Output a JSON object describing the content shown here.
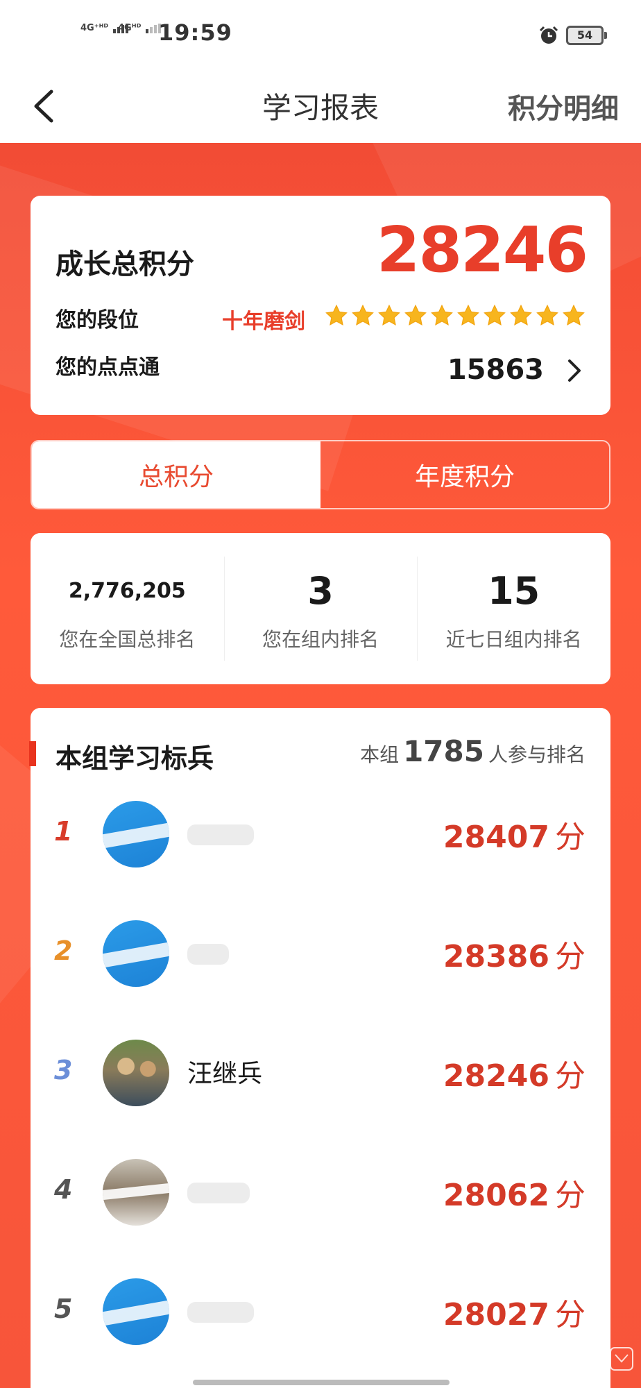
{
  "status_bar": {
    "net1": "4G⁺ᴴᴰ",
    "net2": "4Gᴴᴰ",
    "time": "19:59",
    "battery": "54"
  },
  "nav": {
    "title": "学习报表",
    "right_link": "积分明细"
  },
  "score_card": {
    "title": "成长总积分",
    "total": "28246",
    "rank_label": "您的段位",
    "rank_name": "十年磨剑",
    "stars": 10,
    "diandian_label": "您的点点通",
    "diandian_value": "15863"
  },
  "tabs": [
    {
      "label": "总积分",
      "active": true
    },
    {
      "label": "年度积分",
      "active": false
    }
  ],
  "stats": [
    {
      "value": "2,776,205",
      "label": "您在全国总排名"
    },
    {
      "value": "3",
      "label": "您在组内排名"
    },
    {
      "value": "15",
      "label": "近七日组内排名"
    }
  ],
  "board": {
    "title": "本组学习标兵",
    "meta_prefix": "本组",
    "meta_count": "1785",
    "meta_suffix": "人参与排名",
    "unit": "分",
    "rows": [
      {
        "rank": "1",
        "name": "",
        "score": "28407",
        "rank_color": "#d83c2a",
        "avatar": "blue"
      },
      {
        "rank": "2",
        "name": "",
        "score": "28386",
        "rank_color": "#e8902a",
        "avatar": "blue"
      },
      {
        "rank": "3",
        "name": "汪继兵",
        "score": "28246",
        "rank_color": "#6b8ed8",
        "avatar": "photo"
      },
      {
        "rank": "4",
        "name": "",
        "score": "28062",
        "rank_color": "#555555",
        "avatar": "photo2"
      },
      {
        "rank": "5",
        "name": "",
        "score": "28027",
        "rank_color": "#555555",
        "avatar": "blue"
      }
    ]
  }
}
